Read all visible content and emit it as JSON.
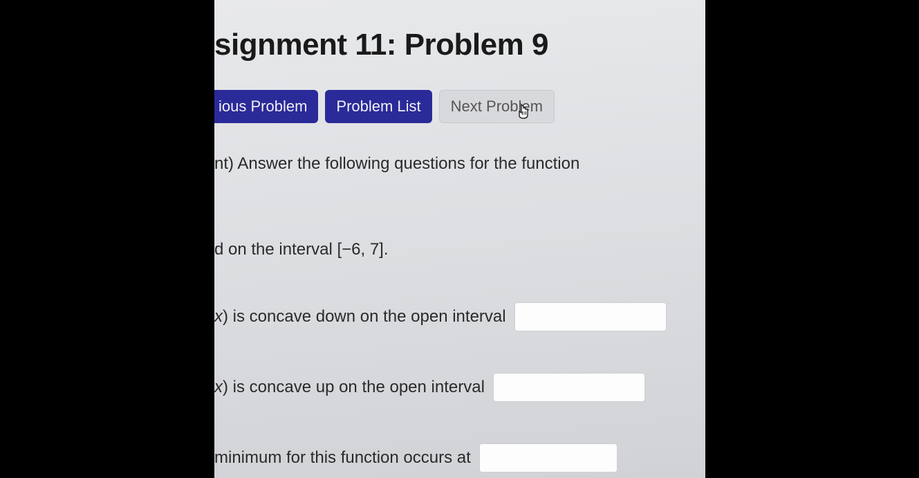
{
  "header": {
    "title_visible": "signment 11: Problem 9"
  },
  "nav": {
    "prev_label": "ious Problem",
    "list_label": "Problem List",
    "next_label": "Next Problem"
  },
  "problem": {
    "intro_fragment": "nt) Answer the following questions for the function",
    "interval_fragment": "d on the interval [−6, 7].",
    "concave_down_prefix": "x",
    "concave_down_text": ") is concave down on the open interval",
    "concave_up_prefix": "x",
    "concave_up_text": ") is concave up on the open interval",
    "minimum_text": " minimum for this function occurs at"
  },
  "inputs": {
    "concave_down_value": "",
    "concave_up_value": "",
    "minimum_value": ""
  }
}
